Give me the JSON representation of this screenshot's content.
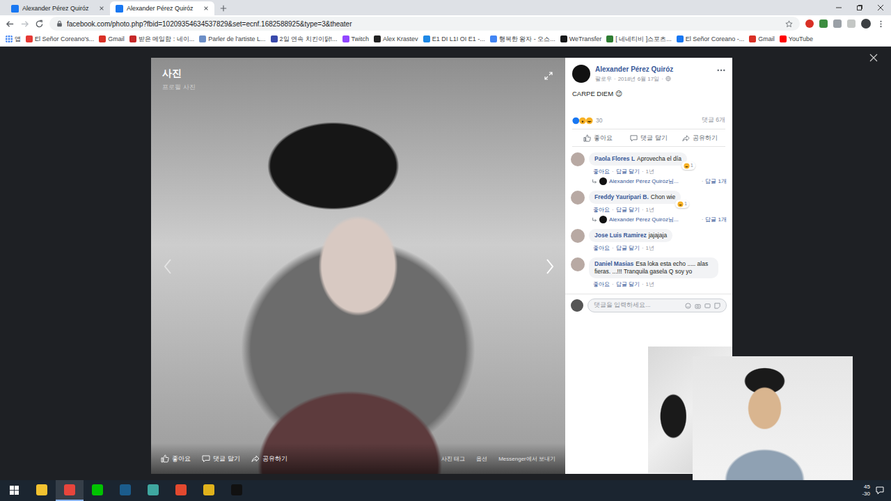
{
  "browser": {
    "tabs": [
      {
        "label": "Alexander Pérez Quiróz",
        "selected": false
      },
      {
        "label": "Alexander Pérez Quiróz",
        "selected": true
      }
    ],
    "address": "facebook.com/photo.php?fbid=10209354634537829&set=ecnf.1682588925&type=3&theater",
    "bookmarks": [
      {
        "label": "앱",
        "kind": "apps",
        "color": "#4285f4"
      },
      {
        "label": "El Señor Coreano's...",
        "kind": "link",
        "color": "#e53935"
      },
      {
        "label": "Gmail",
        "kind": "link",
        "color": "#d93025"
      },
      {
        "label": "받은 메일함 : 네이...",
        "kind": "link",
        "color": "#c62828"
      },
      {
        "label": "Parler de l'artiste L...",
        "kind": "link",
        "color": "#6d8fc7"
      },
      {
        "label": "2일 연속 치킨이닭!...",
        "kind": "link",
        "color": "#3949ab"
      },
      {
        "label": "Twitch",
        "kind": "link",
        "color": "#9146ff"
      },
      {
        "label": "Alex Krastev",
        "kind": "link",
        "color": "#222222"
      },
      {
        "label": "E1 DI L1I OI E1 -...",
        "kind": "link",
        "color": "#1e88e5"
      },
      {
        "label": "행복한 왕자 - 오스...",
        "kind": "link",
        "color": "#4285f4"
      },
      {
        "label": "WeTransfer",
        "kind": "link",
        "color": "#17181a"
      },
      {
        "label": "[ 네네티비 ]스포츠...",
        "kind": "link",
        "color": "#2e7d32"
      },
      {
        "label": "El Señor Coreano -...",
        "kind": "link",
        "color": "#1877f2"
      },
      {
        "label": "Gmail",
        "kind": "link",
        "color": "#d93025"
      },
      {
        "label": "YouTube",
        "kind": "link",
        "color": "#ff0000"
      }
    ]
  },
  "viewer": {
    "title": "사진",
    "subtitle": "프로필 사진",
    "photo_actions": [
      "좋아요",
      "댓글 달기",
      "공유하기"
    ],
    "photo_options": [
      "사진 태그",
      "옵션",
      "Messenger에서 보내기"
    ]
  },
  "post": {
    "author": "Alexander Pérez Quiróz",
    "follow": "팔로우",
    "separator": "·",
    "date": "2018년 6월 17일",
    "text": "CARPE DIEM 😉",
    "reactions_count": "30",
    "comments_count": "댓글 6개",
    "actions": [
      "좋아요",
      "댓글 달기",
      "공유하기"
    ]
  },
  "comments": [
    {
      "name": "Paola Flores L",
      "text": "Aprovecha el día",
      "meta": [
        "좋아요",
        "답글 달기",
        "1년"
      ],
      "reaction": "1",
      "reply": {
        "name": "Alexander Pérez Quiróz님...",
        "count": "답글 1개"
      }
    },
    {
      "name": "Freddy Yauripari B.",
      "text": "Chon wie",
      "meta": [
        "좋아요",
        "답글 달기",
        "1년"
      ],
      "reaction": "1",
      "reply": {
        "name": "Alexander Pérez Quiróz님...",
        "count": "답글 1개"
      }
    },
    {
      "name": "Jose Luis Ramirez",
      "text": "jajajaja",
      "meta": [
        "좋아요",
        "답글 달기",
        "1년"
      ]
    },
    {
      "name": "Daniel Masias",
      "text": "Esa loka esta echo ..... alas fieras. ...!!! Tranquila gasela Q soy yo",
      "meta": [
        "좋아요",
        "답글 달기",
        "1년"
      ]
    }
  ],
  "composer": {
    "placeholder": "댓글을 입력하세요..."
  },
  "taskbar": {
    "apps": [
      {
        "color": "#f2c230",
        "selected": false
      },
      {
        "color": "#e8453c",
        "selected": true
      },
      {
        "color": "#00c300",
        "selected": false
      },
      {
        "color": "#1b5c8c",
        "selected": false
      },
      {
        "color": "#3fa7a0",
        "selected": false
      },
      {
        "color": "#e2492f",
        "selected": false
      },
      {
        "color": "#e0b21c",
        "selected": false
      },
      {
        "color": "#111111",
        "selected": false
      }
    ],
    "clock": [
      "45",
      "-30"
    ]
  }
}
